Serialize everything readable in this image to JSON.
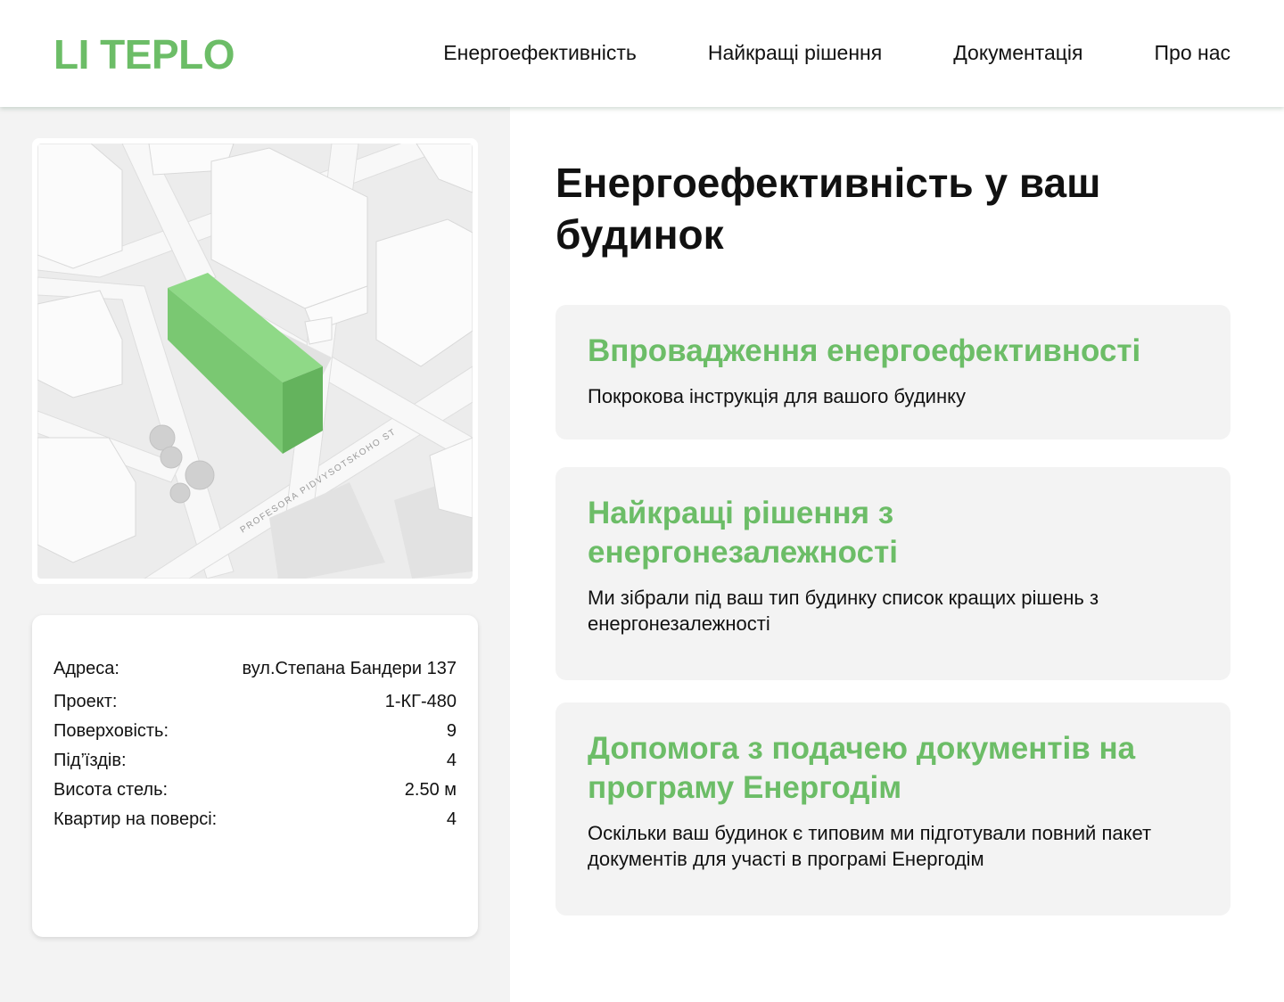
{
  "header": {
    "logo": "LI TEPLO",
    "nav": [
      "Енергоефективність",
      "Найкращі рішення",
      "Документація",
      "Про нас"
    ]
  },
  "map": {
    "street_label": "PROFESORA PIDVYSOTSKOHO ST",
    "highlight_color": "#7ac872"
  },
  "building_info": {
    "rows": [
      {
        "label": "Адреса:",
        "value": "вул.Степана Бандери 137"
      },
      {
        "label": "Проект:",
        "value": "1-КГ-480"
      },
      {
        "label": "Поверховість:",
        "value": "9"
      },
      {
        "label": "Під’їздів:",
        "value": "4"
      },
      {
        "label": "Висота стель:",
        "value": "2.50 м"
      },
      {
        "label": "Квартир на поверсі:",
        "value": "4"
      }
    ]
  },
  "main": {
    "title": "Енергоефективність у ваш будинок",
    "features": [
      {
        "title": "Впровадження енергоефективності",
        "description": "Покрокова інструкція для вашого будинку"
      },
      {
        "title": "Найкращі рішення з енергонезалежності",
        "description": "Ми зібрали під ваш тип будинку список кращих рішень з енергонезалежності"
      },
      {
        "title": "Допомога з подачею документів на програму Енергодім",
        "description": "Оскільки ваш будинок є типовим ми підготували повний пакет документів для участі в програмі Енергодім"
      }
    ]
  },
  "colors": {
    "accent": "#6cbd67",
    "panel": "#f3f3f3"
  }
}
